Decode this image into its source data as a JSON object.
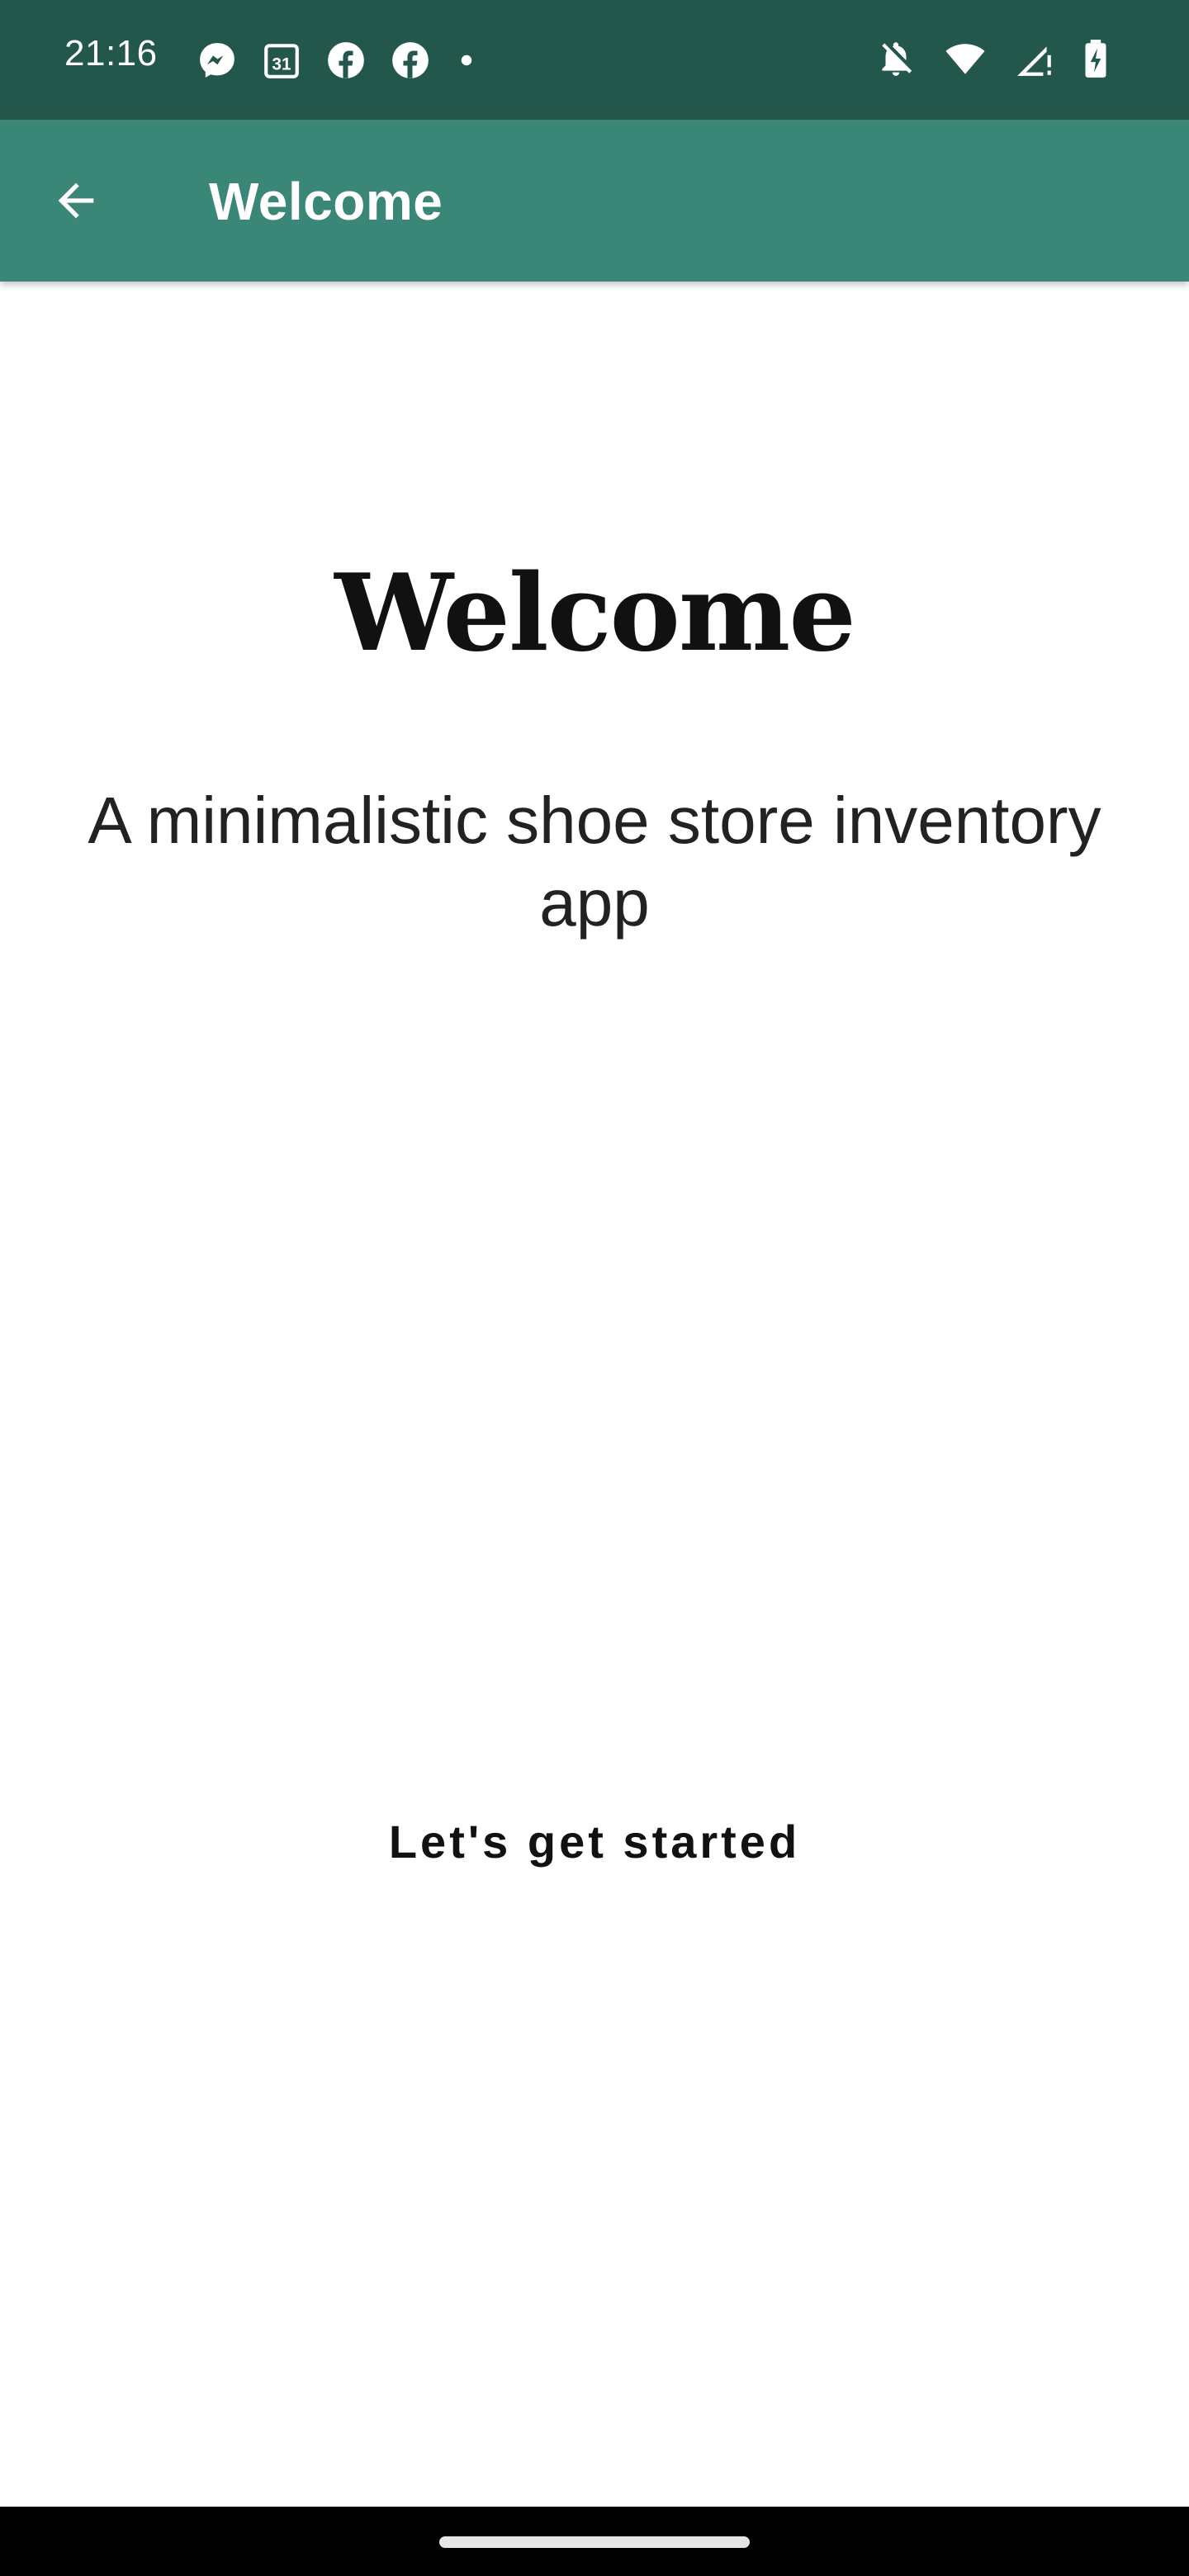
{
  "status_bar": {
    "time": "21:16",
    "left_icons": [
      "messenger-icon",
      "calendar-icon",
      "facebook-icon",
      "facebook-icon",
      "dot-icon"
    ],
    "calendar_day": "31",
    "right_icons": [
      "notifications-off-icon",
      "wifi-icon",
      "signal-icon",
      "battery-charging-icon"
    ],
    "background_color": "#24574b"
  },
  "app_bar": {
    "title": "Welcome",
    "back_icon": "arrow-back-icon",
    "background_color": "#3b8777"
  },
  "main": {
    "heading": "Welcome",
    "subtitle": "A minimalistic shoe store inventory app",
    "start_button_label": "Let's get started"
  },
  "nav_bar": {
    "handle": "home-gesture-handle"
  }
}
